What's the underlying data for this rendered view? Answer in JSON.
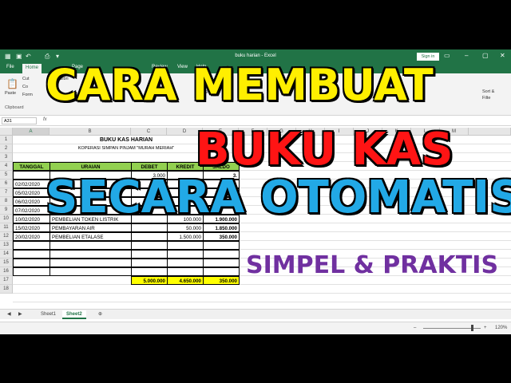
{
  "app": {
    "doc_title": "buku harian  -  Excel",
    "signin_label": "Sign in"
  },
  "tabs": [
    "File",
    "Home",
    "Page",
    "Review",
    "View",
    "Help"
  ],
  "ribbon": {
    "paste": "Paste",
    "cut": "Cut",
    "copy": "Co",
    "format": "Form",
    "clipboard": "Clipboard",
    "wrap": "Wrap",
    "merge": "Merg",
    "sort": "Sort &",
    "filter": "Filte",
    "calib": "Calibri",
    "tell": "ll m"
  },
  "formula": {
    "namebox": "A31",
    "fx": "fx"
  },
  "columns": [
    "A",
    "B",
    "C",
    "D",
    "E",
    "F",
    "G",
    "H",
    "I",
    "J",
    "K",
    "L",
    "M"
  ],
  "rows": [
    "1",
    "2",
    "3",
    "4",
    "5",
    "6",
    "7",
    "8",
    "9",
    "10",
    "11",
    "12",
    "13",
    "14",
    "15",
    "16",
    "17",
    "18"
  ],
  "sheet": {
    "title": "BUKU KAS HARIAN",
    "subtitle": "KOPERASI SIMPAN PINJAM \"MURAH MERIAH\"",
    "headers": [
      "TANGGAL",
      "URAIAN",
      "DEBET",
      "KREDIT",
      "SALDO"
    ],
    "rows": [
      [
        "",
        "",
        "3.000",
        "",
        "3."
      ],
      [
        "02/02/2020",
        "",
        "",
        "",
        ""
      ],
      [
        "05/02/2020",
        "",
        "",
        "",
        ""
      ],
      [
        "06/02/2020",
        "",
        "",
        "",
        ""
      ],
      [
        "07/02/2020",
        "",
        "",
        "",
        ""
      ],
      [
        "10/02/2020",
        "PEMBELIAN TOKEN LISTRIK",
        "",
        "100.000",
        "1.900.000"
      ],
      [
        "15/02/2020",
        "PEMBAYARAN AIR",
        "",
        "50.000",
        "1.850.000"
      ],
      [
        "20/02/2020",
        "PEMBELIAN ETALASE",
        "",
        "1.500.000",
        "350.000"
      ]
    ],
    "totals": [
      "5.000.000",
      "4.650.000",
      "350.000"
    ]
  },
  "sheet_tabs": [
    "Sheet1",
    "Sheet2"
  ],
  "status": {
    "zoom": "120%"
  },
  "overlay": {
    "line1": "CARA MEMBUAT",
    "line2": "BUKU KAS",
    "line3": "SECARA OTOMATIS",
    "line4": "SIMPEL & PRAKTIS"
  },
  "colors": {
    "excel_green": "#217346",
    "header_fill": "#92d050",
    "total_fill": "#ffff00",
    "overlay_yellow": "#ffef00",
    "overlay_red": "#ff1414",
    "overlay_blue": "#22a9e6",
    "overlay_purple": "#7030a0"
  }
}
